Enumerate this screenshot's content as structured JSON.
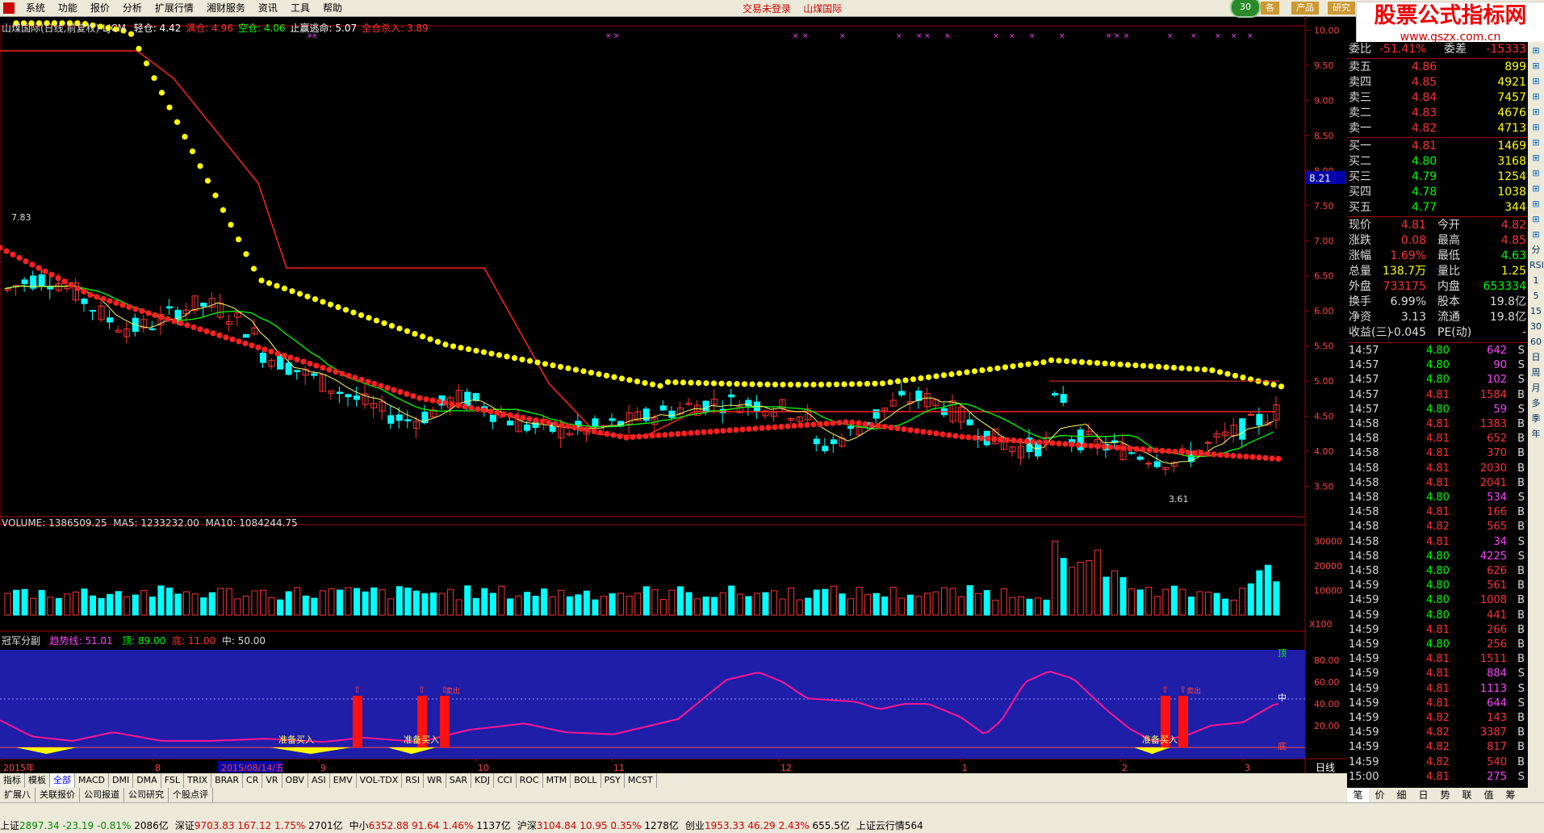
{
  "menu": [
    "系统",
    "功能",
    "报价",
    "分析",
    "扩展行情",
    "湘财服务",
    "资讯",
    "工具",
    "帮助"
  ],
  "title_center": {
    "status": "交易未登录",
    "stock": "山煤国际"
  },
  "top_badge": "30",
  "top_buttons": [
    "各",
    "产品",
    "研究"
  ],
  "watermark": {
    "line1": "股票公式指标网",
    "line2": "www.gszx.com.cn"
  },
  "chart_header": {
    "name": "山煤国际(日线,前复权) LJCM",
    "items": [
      {
        "label": "轻仓: 4.42",
        "color": "#ffffff"
      },
      {
        "label": "满仓: 4.96",
        "color": "#ff3333"
      },
      {
        "label": "空仓: 4.06",
        "color": "#00ff00"
      },
      {
        "label": "止赢逃命: 5.07",
        "color": "#ffffff"
      },
      {
        "label": "全仓杀入: 3.89",
        "color": "#ff3333"
      }
    ]
  },
  "price_axis": [
    "10.00",
    "9.50",
    "9.00",
    "8.50",
    "8.00",
    "7.50",
    "7.00",
    "6.50",
    "6.00",
    "5.50",
    "5.00",
    "4.50",
    "4.00",
    "3.50"
  ],
  "price_marker": "8.21",
  "high_label": "7.83",
  "low_label": "3.61",
  "volume_header": {
    "label": "VOLUME: 1386509.25",
    "ma5": "MA5: 1233232.00",
    "ma10": "MA10: 1084244.75"
  },
  "volume_axis": [
    "30000",
    "20000",
    "10000"
  ],
  "volume_unit": "X100",
  "indicator_header": {
    "name": "冠军分副",
    "trend": "趋势线: 51.01",
    "top": "顶: 89.00",
    "bottom": "底: 11.00",
    "mid": "中: 50.00"
  },
  "indicator_axis": [
    "80.00",
    "60.00",
    "40.00",
    "20.00"
  ],
  "indicator_top_tag": "顶",
  "indicator_mid_tag": "中",
  "indicator_bottom_tag": "底",
  "buy_labels": [
    "准备买入",
    "准备买入",
    "准备买入"
  ],
  "sell_tags": [
    "卖出",
    "卖出"
  ],
  "date_axis": [
    "2015年",
    "8",
    "2015/08/14/五",
    "9",
    "10",
    "11",
    "12",
    "1",
    "2",
    "3"
  ],
  "period_label": "日线",
  "indicator_tabs": [
    "指标",
    "模板",
    "全部",
    "MACD",
    "DMI",
    "DMA",
    "FSL",
    "TRIX",
    "BRAR",
    "CR",
    "VR",
    "OBV",
    "ASI",
    "EMV",
    "VOL-TDX",
    "RSI",
    "WR",
    "SAR",
    "KDJ",
    "CCI",
    "ROC",
    "MTM",
    "BOLL",
    "PSY",
    "MCST"
  ],
  "sub_tabs": [
    "扩展八",
    "关联报价",
    "公司报道",
    "公司研究",
    "个股点评"
  ],
  "quote": {
    "weibi": {
      "label": "委比",
      "value": "-51.41%",
      "label2": "委差",
      "value2": "-15333"
    },
    "asks": [
      {
        "label": "卖五",
        "price": "4.86",
        "vol": "899"
      },
      {
        "label": "卖四",
        "price": "4.85",
        "vol": "4921"
      },
      {
        "label": "卖三",
        "price": "4.84",
        "vol": "7457"
      },
      {
        "label": "卖二",
        "price": "4.83",
        "vol": "4676"
      },
      {
        "label": "卖一",
        "price": "4.82",
        "vol": "4713"
      }
    ],
    "bids": [
      {
        "label": "买一",
        "price": "4.81",
        "vol": "1469"
      },
      {
        "label": "买二",
        "price": "4.80",
        "vol": "3168"
      },
      {
        "label": "买三",
        "price": "4.79",
        "vol": "1254"
      },
      {
        "label": "买四",
        "price": "4.78",
        "vol": "1038"
      },
      {
        "label": "买五",
        "price": "4.77",
        "vol": "344"
      }
    ],
    "stats": [
      {
        "l1": "现价",
        "v1": "4.81",
        "l2": "今开",
        "v2": "4.82",
        "c1": "red",
        "c2": "red"
      },
      {
        "l1": "涨跌",
        "v1": "0.08",
        "l2": "最高",
        "v2": "4.85",
        "c1": "red",
        "c2": "red"
      },
      {
        "l1": "涨幅",
        "v1": "1.69%",
        "l2": "最低",
        "v2": "4.63",
        "c1": "red",
        "c2": "green"
      },
      {
        "l1": "总量",
        "v1": "138.7万",
        "l2": "量比",
        "v2": "1.25",
        "c1": "yellow",
        "c2": "yellow"
      },
      {
        "l1": "外盘",
        "v1": "733175",
        "l2": "内盘",
        "v2": "653334",
        "c1": "red",
        "c2": "green"
      },
      {
        "l1": "换手",
        "v1": "6.99%",
        "l2": "股本",
        "v2": "19.8亿",
        "c1": "white",
        "c2": "white"
      },
      {
        "l1": "净资",
        "v1": "3.13",
        "l2": "流通",
        "v2": "19.8亿",
        "c1": "white",
        "c2": "white"
      },
      {
        "l1": "收益(三)",
        "v1": "-0.045",
        "l2": "PE(动)",
        "v2": "-",
        "c1": "white",
        "c2": "white"
      }
    ],
    "ticks": [
      {
        "t": "14:57",
        "p": "4.80",
        "v": "642",
        "s": "S"
      },
      {
        "t": "14:57",
        "p": "4.80",
        "v": "90",
        "s": "S"
      },
      {
        "t": "14:57",
        "p": "4.80",
        "v": "102",
        "s": "S"
      },
      {
        "t": "14:57",
        "p": "4.81",
        "v": "1584",
        "s": "B"
      },
      {
        "t": "14:57",
        "p": "4.80",
        "v": "59",
        "s": "S"
      },
      {
        "t": "14:58",
        "p": "4.81",
        "v": "1383",
        "s": "B"
      },
      {
        "t": "14:58",
        "p": "4.81",
        "v": "652",
        "s": "B"
      },
      {
        "t": "14:58",
        "p": "4.81",
        "v": "370",
        "s": "B"
      },
      {
        "t": "14:58",
        "p": "4.81",
        "v": "2030",
        "s": "B"
      },
      {
        "t": "14:58",
        "p": "4.81",
        "v": "2041",
        "s": "B"
      },
      {
        "t": "14:58",
        "p": "4.80",
        "v": "534",
        "s": "S"
      },
      {
        "t": "14:58",
        "p": "4.81",
        "v": "166",
        "s": "B"
      },
      {
        "t": "14:58",
        "p": "4.82",
        "v": "565",
        "s": "B"
      },
      {
        "t": "14:58",
        "p": "4.81",
        "v": "34",
        "s": "S"
      },
      {
        "t": "14:58",
        "p": "4.80",
        "v": "4225",
        "s": "S"
      },
      {
        "t": "14:58",
        "p": "4.80",
        "v": "626",
        "s": "B"
      },
      {
        "t": "14:59",
        "p": "4.80",
        "v": "561",
        "s": "B"
      },
      {
        "t": "14:59",
        "p": "4.80",
        "v": "1008",
        "s": "B"
      },
      {
        "t": "14:59",
        "p": "4.80",
        "v": "441",
        "s": "B"
      },
      {
        "t": "14:59",
        "p": "4.81",
        "v": "266",
        "s": "B"
      },
      {
        "t": "14:59",
        "p": "4.80",
        "v": "256",
        "s": "B"
      },
      {
        "t": "14:59",
        "p": "4.81",
        "v": "1511",
        "s": "B"
      },
      {
        "t": "14:59",
        "p": "4.81",
        "v": "884",
        "s": "S"
      },
      {
        "t": "14:59",
        "p": "4.81",
        "v": "1113",
        "s": "S"
      },
      {
        "t": "14:59",
        "p": "4.81",
        "v": "644",
        "s": "S"
      },
      {
        "t": "14:59",
        "p": "4.82",
        "v": "143",
        "s": "B"
      },
      {
        "t": "14:59",
        "p": "4.82",
        "v": "3387",
        "s": "B"
      },
      {
        "t": "14:59",
        "p": "4.82",
        "v": "817",
        "s": "B"
      },
      {
        "t": "14:59",
        "p": "4.82",
        "v": "540",
        "s": "B"
      },
      {
        "t": "15:00",
        "p": "4.81",
        "v": "275",
        "s": "S"
      }
    ]
  },
  "right_tools": [
    "分",
    "RSI",
    "1",
    "5",
    "15",
    "30",
    "60",
    "日",
    "周",
    "月",
    "多",
    "季",
    "年"
  ],
  "right_tabs": [
    "笔",
    "价",
    "细",
    "日",
    "势",
    "联",
    "值",
    "筹"
  ],
  "status_items": [
    {
      "name": "上证",
      "val": "2897.34",
      "chg": "-23.19",
      "pct": "-0.81%",
      "amt": "2086亿"
    },
    {
      "name": "深证",
      "val": "9703.83",
      "chg": "167.12",
      "pct": "1.75%",
      "amt": "2701亿"
    },
    {
      "name": "中小",
      "val": "6352.88",
      "chg": "91.64",
      "pct": "1.46%",
      "amt": "1137亿"
    },
    {
      "name": "沪深",
      "val": "3104.84",
      "chg": "10.95",
      "pct": "0.35%",
      "amt": "1278亿"
    },
    {
      "name": "创业",
      "val": "1953.33",
      "chg": "46.29",
      "pct": "2.43%",
      "amt": "655.5亿"
    }
  ],
  "status_tail": "上证云行情564",
  "colors": {
    "up": "#ff3333",
    "down": "#00ffff",
    "yellow_line": "#ffff00",
    "green_line": "#00ff00",
    "indicator_bg": "#1a1aa8",
    "magenta": "#ff1493"
  }
}
